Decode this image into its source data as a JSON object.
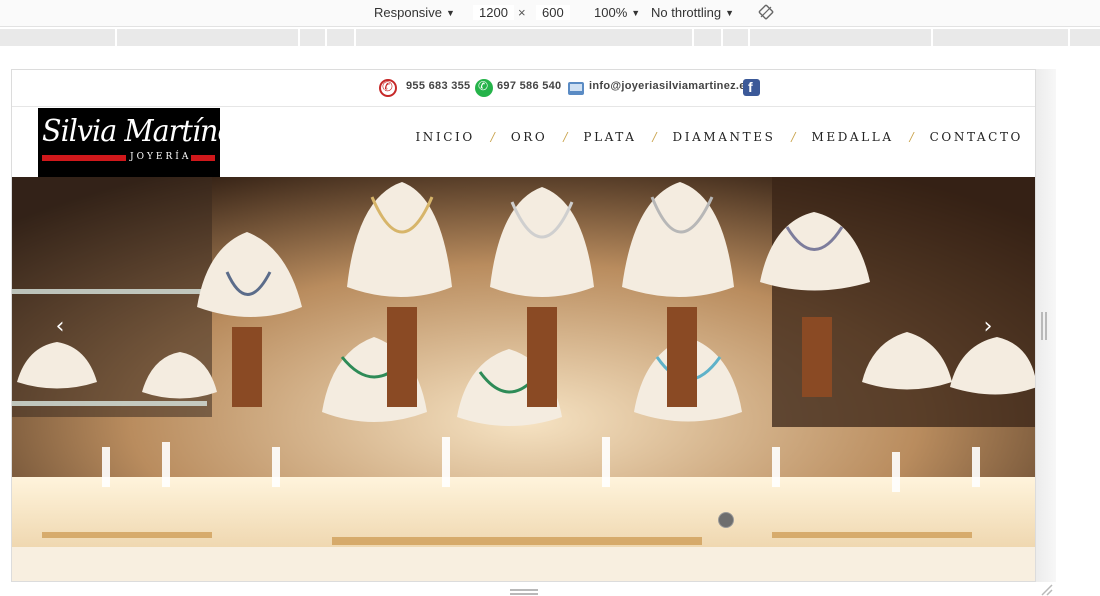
{
  "devtools": {
    "mode": "Responsive",
    "width": "1200",
    "times": "×",
    "height": "600",
    "zoom": "100%",
    "throttle": "No throttling",
    "rotate_icon": "rotate-icon"
  },
  "contact": {
    "phone": "955 683 355",
    "whatsapp": "697 586 540",
    "email": "info@joyeriasilviamartinez.es",
    "icons": [
      "phone-icon",
      "whatsapp-icon",
      "mail-icon",
      "facebook-icon"
    ]
  },
  "logo": {
    "script": "Silvia Martínez",
    "sub": "JOYERÍA"
  },
  "nav": {
    "items": [
      "INICIO",
      "ORO",
      "PLATA",
      "DIAMANTES",
      "MEDALLA",
      "CONTACTO"
    ],
    "separator": "/"
  },
  "slider": {
    "prev": "‹",
    "next": "›",
    "active_dot": 1
  },
  "colors": {
    "accent_red": "#d0181b",
    "nav_separator_gold": "#c9a24a",
    "whatsapp_green": "#25b34a",
    "facebook_blue": "#3b5998"
  }
}
